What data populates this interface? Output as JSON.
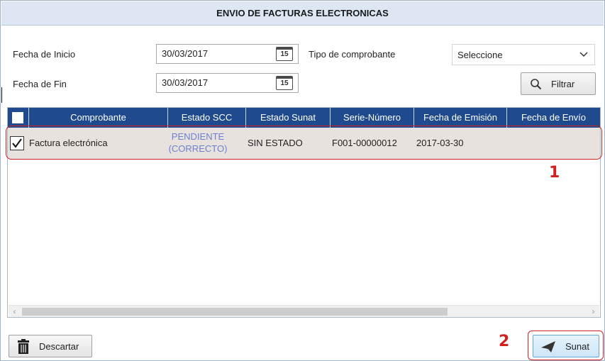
{
  "window": {
    "title": "ENVIO DE FACTURAS ELECTRONICAS"
  },
  "filters": {
    "start_label": "Fecha de Inicio",
    "start_value": "30/03/2017",
    "end_label": "Fecha de Fin",
    "end_value": "30/03/2017",
    "calendar_day": "15",
    "type_label": "Tipo de comprobante",
    "type_value": "Seleccione",
    "filter_button": "Filtrar"
  },
  "grid": {
    "columns": [
      "Comprobante",
      "Estado SCC",
      "Estado Sunat",
      "Serie-Número",
      "Fecha de Emisión",
      "Fecha de Envío"
    ],
    "rows": [
      {
        "checked": true,
        "comprobante": "Factura electrónica",
        "estado_scc_line1": "PENDIENTE",
        "estado_scc_line2": "(CORRECTO)",
        "estado_sunat": "SIN ESTADO",
        "serie_numero": "F001-00000012",
        "fecha_emision": "2017-03-30",
        "fecha_envio": ""
      }
    ]
  },
  "footer": {
    "discard_button": "Descartar",
    "sunat_button": "Sunat"
  },
  "annotations": {
    "marker_1": "1",
    "marker_2": "2"
  },
  "colors": {
    "header_bg": "#1f4b8e",
    "title_bg": "#dde7f3",
    "row_bg": "#e8e2df",
    "link": "#6f7fd1",
    "annotation": "#d21f1f"
  }
}
